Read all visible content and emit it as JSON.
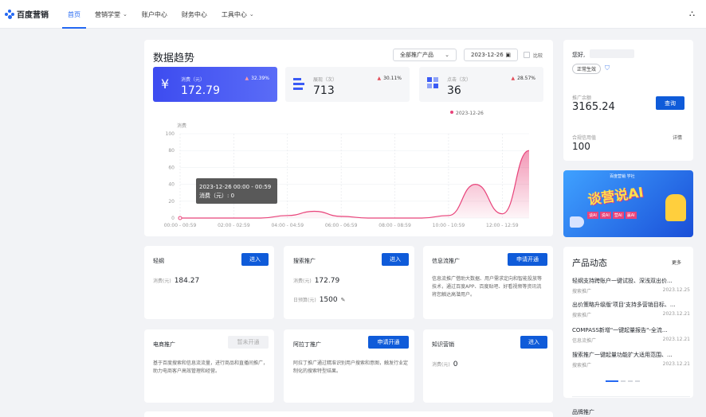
{
  "brand": {
    "name": "百度营销"
  },
  "nav": {
    "items": [
      {
        "label": "首页"
      },
      {
        "label": "营销学堂"
      },
      {
        "label": "账户中心"
      },
      {
        "label": "财务中心"
      },
      {
        "label": "工具中心"
      }
    ]
  },
  "trend": {
    "title": "数据趋势",
    "product_select": "全部推广产品",
    "date": "2023-12-26",
    "compare_label": "比较",
    "stats": [
      {
        "label": "消费（元）",
        "value": "172.79",
        "change": "32.39%"
      },
      {
        "label": "展现（次）",
        "value": "713",
        "change": "30.11%"
      },
      {
        "label": "点击（次）",
        "value": "36",
        "change": "28.57%"
      }
    ],
    "tooltip": {
      "line1": "2023-12-26 00:00 - 00:59",
      "line2": "消费（元）: 0"
    }
  },
  "chart_data": {
    "type": "area",
    "legend": [
      "2023-12-26"
    ],
    "ylabel": "消费",
    "ylim": [
      0,
      100
    ],
    "yticks": [
      "100",
      "80",
      "60",
      "40",
      "20",
      "0"
    ],
    "xticks": [
      "00:00 - 00:59",
      "02:00 - 02:59",
      "04:00 - 04:59",
      "06:00 - 06:59",
      "08:00 - 08:59",
      "10:00 - 10:59",
      "12:00 - 12:59"
    ],
    "x": [
      0,
      1,
      2,
      3,
      4,
      5,
      6,
      7,
      8,
      9,
      10,
      11,
      12,
      13
    ],
    "values": [
      0,
      0,
      0,
      0,
      3,
      8,
      2,
      0,
      0,
      0,
      3,
      40,
      5,
      80
    ],
    "color": "#e8437a"
  },
  "account": {
    "greeting": "您好,",
    "status": "正常生效",
    "balance_label": "推广余额",
    "balance": "3165.24",
    "query_button": "查询",
    "credit_label": "合规信用值",
    "credit": "100",
    "detail_link": "详情"
  },
  "banner": {
    "top": "百度营销 学社",
    "main": "谈营说AI",
    "sub": [
      "谈AI",
      "说AI",
      "营AI",
      "赢AI"
    ]
  },
  "modules": [
    {
      "title": "轻纲",
      "button": "进入",
      "lines": [
        {
          "label": "消费(元)",
          "value": "184.27"
        }
      ]
    },
    {
      "title": "搜索推广",
      "button": "进入",
      "lines": [
        {
          "label": "消费(元)",
          "value": "172.79"
        },
        {
          "label": "日预算(元)",
          "value": "1500"
        }
      ]
    },
    {
      "title": "信息流推广",
      "button": "申请开通",
      "desc": "信息流推广借助大数据、用户需求定向和智能投放等技术，通过百度APP、百度贴吧、好看视频等资讯流将您触达高潜用户。"
    },
    {
      "title": "电商推广",
      "button": "暂未开通",
      "desc": "基于百度搜索和信息流流量，进行商品和直播间推广，助力电商客户高效管理和经营。"
    },
    {
      "title": "阿拉丁推广",
      "button": "申请开通",
      "desc": "阿拉丁推广通过精准识别用户搜索和意图，触发行业定制化的搜索特型结果。"
    },
    {
      "title": "知识营销",
      "button": "进入",
      "lines": [
        {
          "label": "消费(元)",
          "value": "0"
        }
      ]
    }
  ],
  "news": {
    "title": "产品动态",
    "more": "更多",
    "items": [
      {
        "text": "轻纲支持跨账户一键试投、深浅双出价...",
        "tag": "搜索推广",
        "date": "2023.12.25"
      },
      {
        "text": "出价策略升级版'项目'支持多营销目标、...",
        "tag": "搜索推广",
        "date": "2023.12.21"
      },
      {
        "text": "COMPASS新增\"一键起量报告\"-全流...",
        "tag": "信息流推广",
        "date": "2023.12.21"
      },
      {
        "text": "搜索推广一键起量功能扩大适用范围、...",
        "tag": "搜索推广",
        "date": "2023.12.21"
      }
    ]
  },
  "brand_promo": {
    "title": "品牌推广"
  }
}
